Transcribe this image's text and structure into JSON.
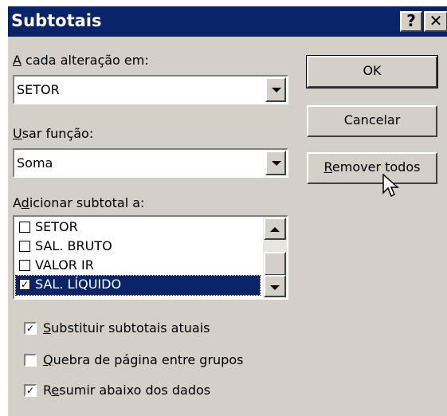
{
  "window": {
    "title": "Subtotais",
    "help_label": "?",
    "close_label": "✕"
  },
  "group_by": {
    "label_accel": "A",
    "label_rest": " cada alteração em:",
    "value": "SETOR"
  },
  "function": {
    "label_accel": "U",
    "label_rest": "sar função:",
    "value": "Soma"
  },
  "add_to": {
    "label_pre": "A",
    "label_accel": "d",
    "label_rest": "icionar subtotal a:",
    "items": [
      {
        "label": "SETOR",
        "checked": false,
        "selected": false
      },
      {
        "label": "SAL. BRUTO",
        "checked": false,
        "selected": false
      },
      {
        "label": "VALOR IR",
        "checked": false,
        "selected": false
      },
      {
        "label": "SAL. LÍQUIDO",
        "checked": true,
        "selected": true
      }
    ]
  },
  "options": {
    "replace": {
      "accel": "S",
      "rest": "ubstituir subtotais atuais",
      "checked": true
    },
    "page_break": {
      "accel": "Q",
      "rest": "uebra de página entre grupos",
      "checked": false
    },
    "summary": {
      "pre": "R",
      "accel": "e",
      "rest": "sumir abaixo dos dados",
      "checked": true
    }
  },
  "buttons": {
    "ok": "OK",
    "cancel": "Cancelar",
    "remove_accel": "R",
    "remove_rest": "emover todos"
  }
}
